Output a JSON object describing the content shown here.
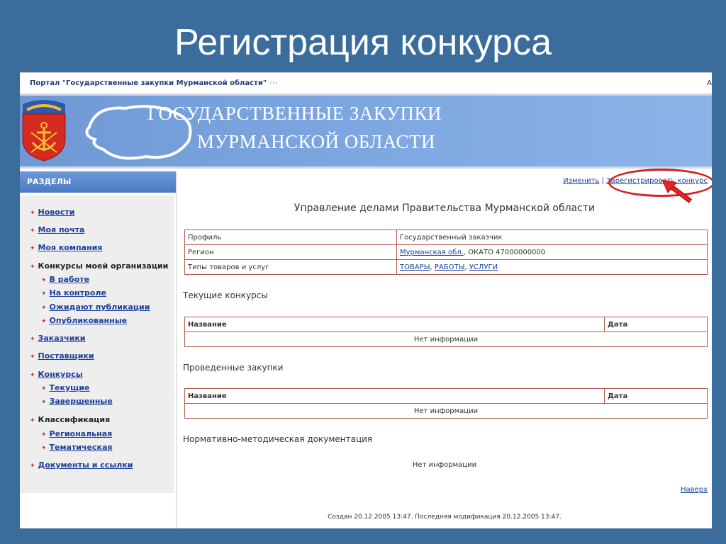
{
  "slide": {
    "title": "Регистрация конкурса"
  },
  "topbar": {
    "portal_name": "Портал \"Государственные закупки Мурманской области\"",
    "arrows": "›››",
    "letter": "А"
  },
  "banner": {
    "line1": "ГОСУДАРСТВЕННЫЕ ЗАКУПКИ",
    "line2": "МУРМАНСКОЙ ОБЛАСТИ"
  },
  "sidebar": {
    "title": "РАЗДЕЛЫ",
    "items": [
      "Новости",
      "Моя почта",
      "Моя компания",
      "Конкурсы моей организации",
      "В работе",
      "На контроле",
      "Ожидают публикации",
      "Опубликованные",
      "Заказчики",
      "Поставщики",
      "Конкурсы",
      "Текущие",
      "Завершенные",
      "Классификация",
      "Региональная",
      "Тематическая",
      "Документы и ссылки"
    ]
  },
  "main": {
    "edit_link": "Изменить",
    "separator": "|",
    "register_link": "Зарегистрировать конкурс",
    "org_title": "Управление делами Правительства Мурманской области",
    "info": {
      "profile_label": "Профиль",
      "profile_value": "Государственный заказчик",
      "region_label": "Регион",
      "region_link": "Мурманская обл.",
      "region_rest": ", ОКАТО 47000000000",
      "types_label": "Типы товаров и услуг",
      "type1": "ТОВАРЫ",
      "type2": "РАБОТЫ",
      "type3": "УСЛУГИ",
      "comma": ","
    },
    "current_title": "Текущие конкурсы",
    "past_title": "Проведенные закупки",
    "docs_title": "Нормативно-методическая документация",
    "col_name": "Название",
    "col_date": "Дата",
    "no_info": "Нет информации",
    "to_top": "Наверх",
    "footer": "Создан 20.12.2005 13:47. Последняя модификация 20.12.2005 13:47."
  },
  "colors": {
    "background": "#3a6c9c",
    "accent_red": "#d81e1e",
    "link": "#1a3f99"
  }
}
